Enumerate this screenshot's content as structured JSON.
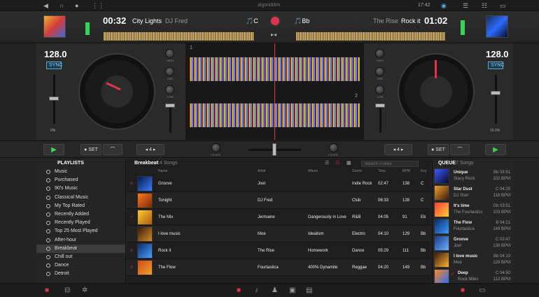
{
  "menubar": {
    "time": "17:42",
    "brand": "algoriddim"
  },
  "deck_left": {
    "time": "00:32",
    "title": "City Lights",
    "artist": "DJ Fred",
    "key": "C",
    "bpm": "128.0",
    "sync": "SYNC",
    "pitch": "0%",
    "set": "SET",
    "loop": "4"
  },
  "deck_right": {
    "time": "01:02",
    "title": "Rock it",
    "artist": "The Rise",
    "key": "Bb",
    "bpm": "128.0",
    "sync": "SYNC",
    "pitch": "15.0%",
    "set": "SET",
    "loop": "4"
  },
  "mixer": {
    "high": "HIGH",
    "mid": "MID",
    "low": "LOW",
    "filter": "FILTER",
    "deck1": "1",
    "deck2": "2"
  },
  "sidebar": {
    "title": "PLAYLISTS",
    "items": [
      "Music",
      "Purchased",
      "90's Music",
      "Classical Music",
      "My Top Rated",
      "Recently Added",
      "Recently Played",
      "Top 25 Most Played",
      "After-hour",
      "Breakbeat",
      "Chill out",
      "Dance",
      "Detroit"
    ]
  },
  "list": {
    "playlist": "Breakbeat",
    "count": "14 Songs",
    "search_placeholder": "Search iTunes",
    "columns": {
      "name": "Name",
      "artist": "Artist",
      "album": "Album",
      "genre": "Genre",
      "time": "Time",
      "bpm": "BPM",
      "key": "Key"
    },
    "rows": [
      {
        "name": "Groove",
        "artist": "Joel",
        "album": "",
        "genre": "Indie Rock",
        "time": "02:47",
        "bpm": "138",
        "key": "C"
      },
      {
        "name": "Tonight",
        "artist": "DJ Fred",
        "album": "",
        "genre": "Club",
        "time": "06:33",
        "bpm": "128",
        "key": "C"
      },
      {
        "name": "The Mix",
        "artist": "Jermaine",
        "album": "Dangerously in Love",
        "genre": "R&B",
        "time": "04:05",
        "bpm": "91",
        "key": "Eb"
      },
      {
        "name": "I love music",
        "artist": "Moe",
        "album": "Idealism",
        "genre": "Electro",
        "time": "04:10",
        "bpm": "129",
        "key": "Bb"
      },
      {
        "name": "Rock it",
        "artist": "The Rise",
        "album": "Homework",
        "genre": "Dance",
        "time": "05:29",
        "bpm": "111",
        "key": "Bb"
      },
      {
        "name": "The Flow",
        "artist": "Fourtastica",
        "album": "400% Dynamite",
        "genre": "Reggae",
        "time": "04:20",
        "bpm": "149",
        "key": "Bb"
      }
    ]
  },
  "queue": {
    "title": "QUEUE",
    "count": "7 Songs",
    "items": [
      {
        "title": "Unique",
        "artist": "Stacy Rock",
        "key": "Bb 03:51",
        "bpm": "102 BPM"
      },
      {
        "title": "Star Dust",
        "artist": "DJ Starr",
        "key": "C 04:25",
        "bpm": "118 BPM"
      },
      {
        "title": "It's time",
        "artist": "The Fourtastics",
        "key": "Gb 03:51",
        "bpm": "103 BPM"
      },
      {
        "title": "The Flow",
        "artist": "Fourtastica",
        "key": "B 04:21",
        "bpm": "149 BPM"
      },
      {
        "title": "Groove",
        "artist": "Joel",
        "key": "C 02:47",
        "bpm": "138 BPM"
      },
      {
        "title": "I love music",
        "artist": "Moe",
        "key": "Bb 04:10",
        "bpm": "129 BPM"
      },
      {
        "title": "Deep",
        "artist": "Rock Miles",
        "key": "C 04:50",
        "bpm": "112 BPM"
      }
    ]
  },
  "colors": {
    "accent": "#e0344a",
    "sync": "#5aa7d6",
    "play": "#3ad35a"
  }
}
